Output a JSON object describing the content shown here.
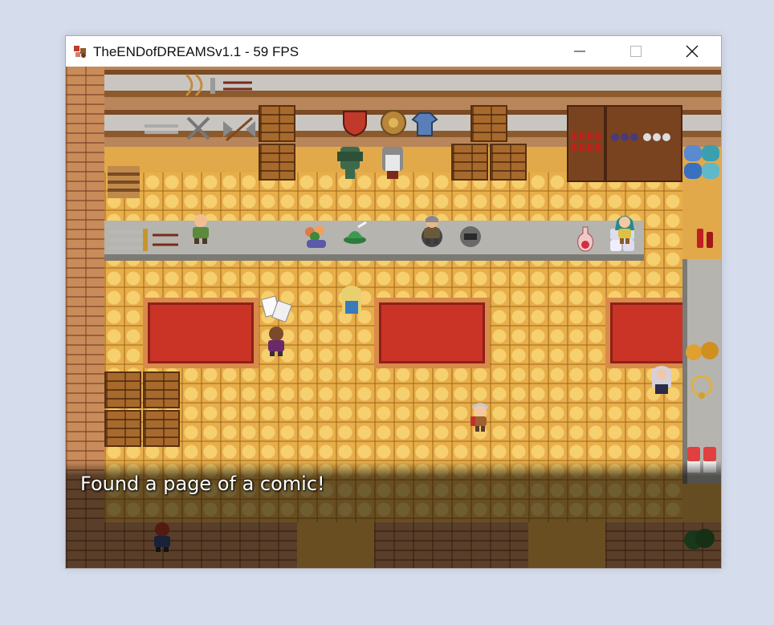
{
  "window": {
    "title": "TheENDofDREAMSv1.1 - 59 FPS",
    "controls": [
      "minimize-icon",
      "maximize-icon",
      "close-icon"
    ]
  },
  "game": {
    "scene": "weapon-and-armor-shop",
    "message": "Found a page of a comic!",
    "colors": {
      "floor": "#e8ae4a",
      "rug": "#c93426",
      "counter": "#b6b4ae",
      "brick": "#c98b5a",
      "desktop": "#d5dcec"
    }
  }
}
